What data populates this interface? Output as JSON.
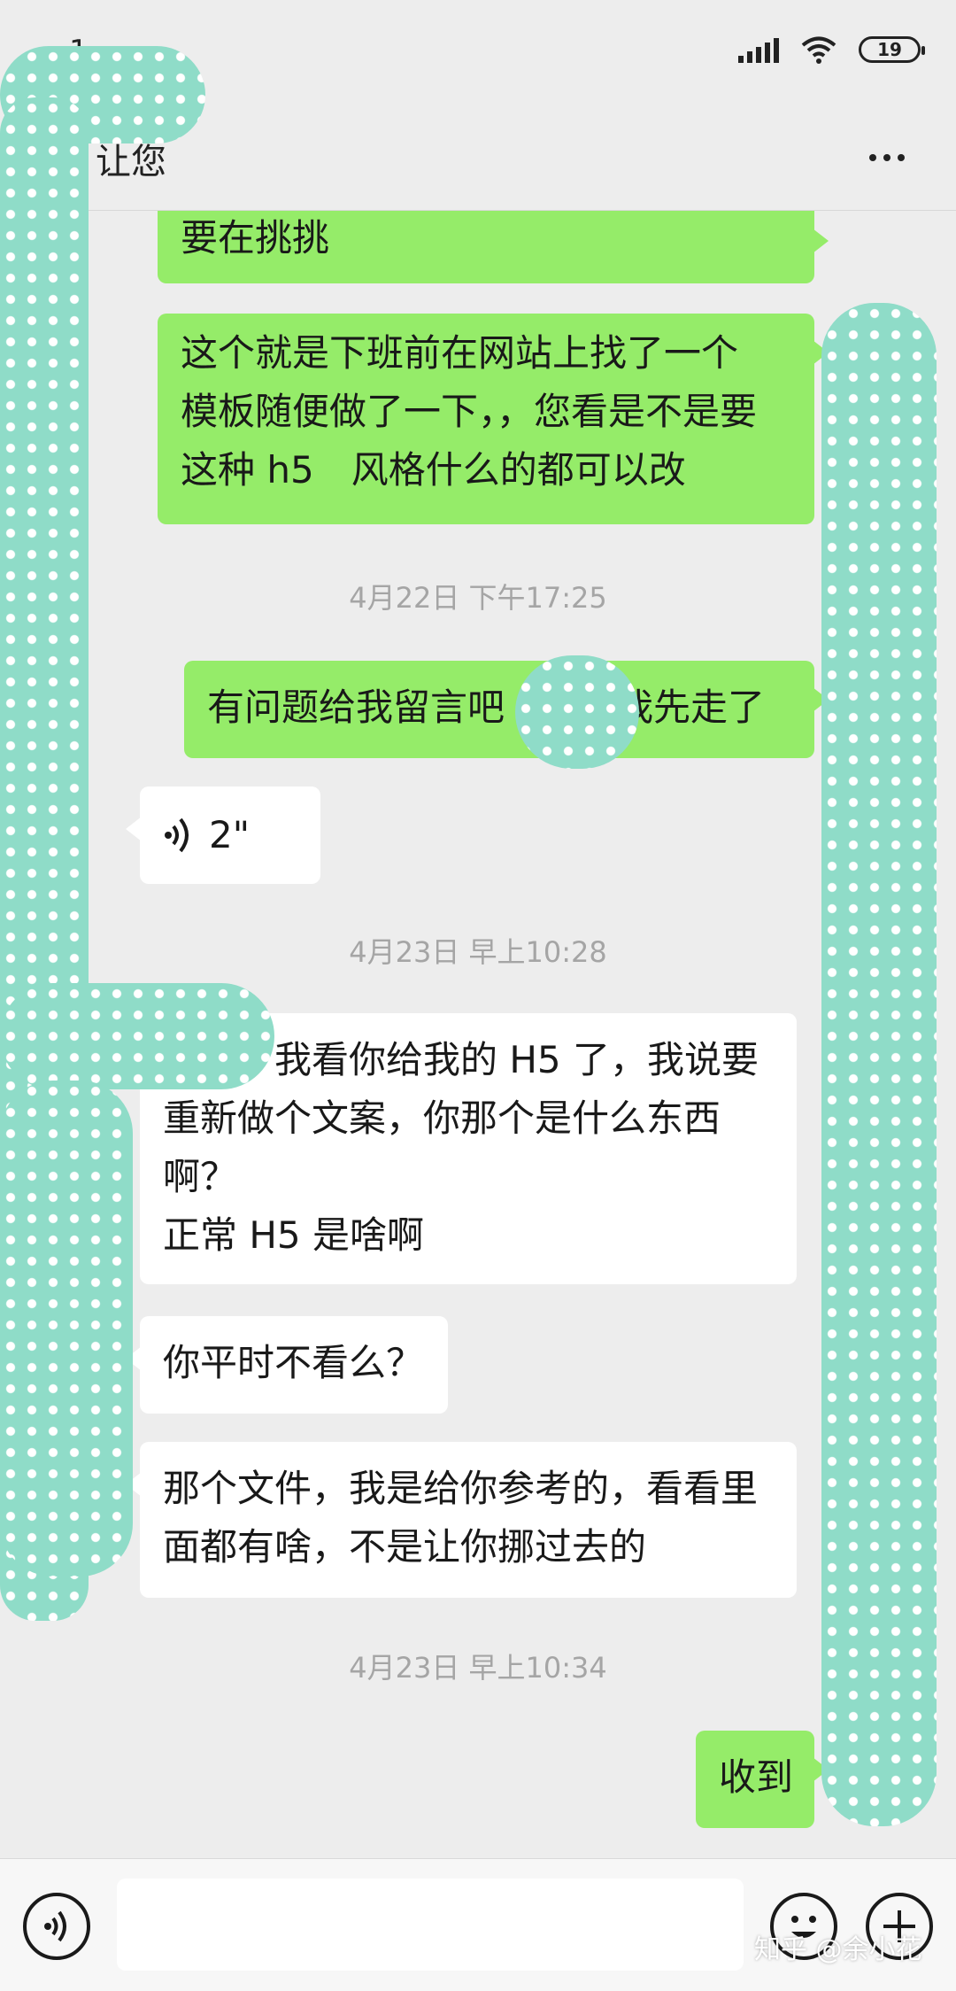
{
  "status_bar": {
    "time": "1",
    "battery": "19"
  },
  "header": {
    "title": "让您"
  },
  "messages": {
    "m1": {
      "lines": [
        "要在挑挑"
      ]
    },
    "m2": {
      "lines": [
        "这个就是下班前在网站上找了一个",
        "模板随便做了一下，，您看是不是要",
        "这种 h5　风格什么的都可以改"
      ]
    },
    "ts1": "4月22日 下午17:25",
    "m3": {
      "lines": [
        "有问题给我留言吧　　　我先走了"
      ]
    },
    "voice": {
      "duration": "2\""
    },
    "ts2": "4月23日 早上10:28",
    "m4": {
      "lines": [
        "　　　我看你给我的 H5 了，我说要",
        "重新做个文案，你那个是什么东西",
        "啊？",
        "正常 H5 是啥啊"
      ]
    },
    "m5": {
      "lines": [
        "你平时不看么？"
      ]
    },
    "m6": {
      "lines": [
        "那个文件，我是给你参考的，看看里",
        "面都有啥，不是让你挪过去的"
      ]
    },
    "ts3": "4月23日 早上10:34",
    "m7": {
      "lines": [
        "收到"
      ]
    }
  },
  "input": {
    "placeholder": ""
  },
  "watermark": "知乎 @余小花",
  "colors": {
    "outgoing_bubble": "#95ec69",
    "incoming_bubble": "#ffffff",
    "background": "#ededed",
    "overlay": "#8fdcc8"
  },
  "icons": {
    "voice": "voice-icon",
    "emoji": "emoji-icon",
    "plus": "plus-icon",
    "more": "more-icon"
  }
}
